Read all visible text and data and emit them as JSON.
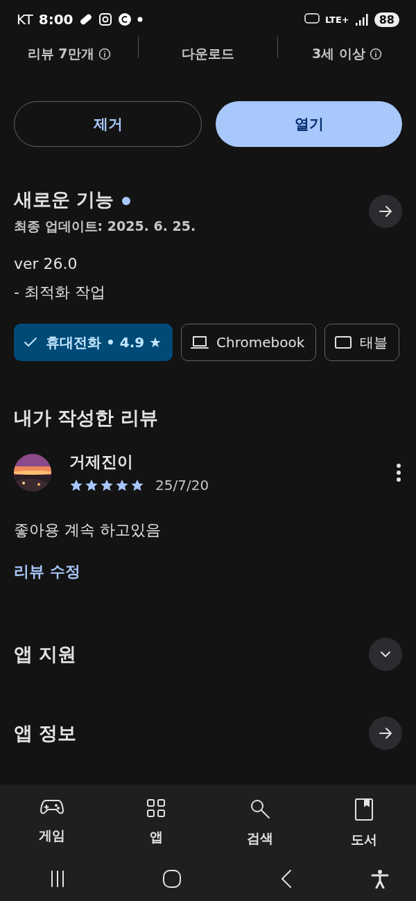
{
  "status_bar": {
    "carrier": "KT",
    "time": "8:00",
    "network": "LTE+",
    "battery": "88"
  },
  "stats": [
    {
      "label": "리뷰 7만개",
      "info": true
    },
    {
      "label": "다운로드",
      "info": false
    },
    {
      "label": "3세 이상",
      "info": true
    }
  ],
  "actions": [
    {
      "label": "제거",
      "kind": "outline"
    },
    {
      "label": "열기",
      "kind": "filled"
    }
  ],
  "whats_new": {
    "title": "새로운 기능",
    "dot": true,
    "updated": "최종 업데이트: 2025. 6. 25.",
    "lines": [
      "ver 26.0",
      "- 최적화 작업"
    ]
  },
  "devices": [
    {
      "label": "휴대전화 • 4.9 ★",
      "selected": true
    },
    {
      "label": "Chromebook",
      "kind": "laptop",
      "selected": false
    },
    {
      "label": "태블",
      "kind": "tablet",
      "selected": false
    }
  ],
  "my_review": {
    "title": "내가 작성한 리뷰",
    "author": "거제진이",
    "stars": 5,
    "date": "25/7/20",
    "text": "좋아용 계속 하고있음",
    "edit_link": "리뷰 수정"
  },
  "sections": [
    {
      "title": "앱 지원",
      "kind": "expand"
    },
    {
      "title": "앱 정보",
      "kind": "arrow"
    }
  ],
  "bottom_nav": [
    {
      "label": "게임",
      "kind": "games"
    },
    {
      "label": "앱",
      "kind": "apps"
    },
    {
      "label": "검색",
      "kind": "search"
    },
    {
      "label": "도서",
      "kind": "books"
    }
  ]
}
